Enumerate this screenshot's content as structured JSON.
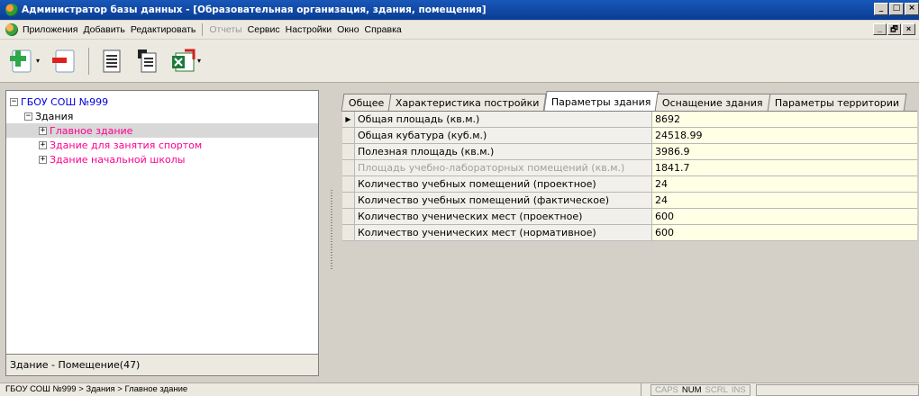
{
  "window": {
    "title": "Администратор базы данных - [Образовательная организация, здания, помещения]",
    "buttons": [
      "_",
      "□",
      "×"
    ]
  },
  "menubar": {
    "items": [
      {
        "label": "Приложения",
        "enabled": true
      },
      {
        "label": "Добавить",
        "enabled": true
      },
      {
        "label": "Редактировать",
        "enabled": true
      },
      {
        "label": "Отчеты",
        "enabled": false
      },
      {
        "label": "Сервис",
        "enabled": true
      },
      {
        "label": "Настройки",
        "enabled": true
      },
      {
        "label": "Окно",
        "enabled": true
      },
      {
        "label": "Справка",
        "enabled": true
      }
    ],
    "mdi_buttons": [
      "_",
      "🗗",
      "×"
    ]
  },
  "toolbar": {
    "buttons": [
      "add-icon",
      "remove-icon",
      "list-icon",
      "copy-icon",
      "excel-icon"
    ]
  },
  "tree": {
    "root": "ГБОУ СОШ №999",
    "group": "Здания",
    "items": [
      "Главное здание",
      "Здание для занятия спортом",
      "Здание начальной школы"
    ],
    "selected_index": 0
  },
  "left_footer": "Здание - Помещение(47)",
  "tabs": [
    {
      "label": "Общее",
      "active": false
    },
    {
      "label": "Характеристика постройки",
      "active": false
    },
    {
      "label": "Параметры здания",
      "active": true
    },
    {
      "label": "Оснащение здания",
      "active": false
    },
    {
      "label": "Параметры территории",
      "active": false
    }
  ],
  "grid": {
    "rows": [
      {
        "label": "Общая площадь (кв.м.)",
        "value": "8692",
        "dim": false
      },
      {
        "label": "Общая кубатура (куб.м.)",
        "value": "24518.99",
        "dim": false
      },
      {
        "label": "Полезная площадь (кв.м.)",
        "value": "3986.9",
        "dim": false
      },
      {
        "label": "Площадь учебно-лабораторных помещений (кв.м.)",
        "value": "1841.7",
        "dim": true
      },
      {
        "label": "Количество учебных помещений (проектное)",
        "value": "24",
        "dim": false
      },
      {
        "label": "Количество учебных помещений (фактическое)",
        "value": "24",
        "dim": false
      },
      {
        "label": "Количество ученических мест (проектное)",
        "value": "600",
        "dim": false
      },
      {
        "label": "Количество ученических мест (нормативное)",
        "value": "600",
        "dim": false
      }
    ]
  },
  "statusbar": {
    "path": "ГБОУ СОШ №999 > Здания > Главное здание",
    "keys": [
      {
        "label": "CAPS",
        "on": false
      },
      {
        "label": "NUM",
        "on": true
      },
      {
        "label": "SCRL",
        "on": false
      },
      {
        "label": "INS",
        "on": false
      }
    ]
  },
  "colors": {
    "title_bar": "#0a3d94",
    "tree_root": "#0000e0",
    "tree_items": "#ff0090",
    "grid_value_bg": "#ffffe6"
  }
}
